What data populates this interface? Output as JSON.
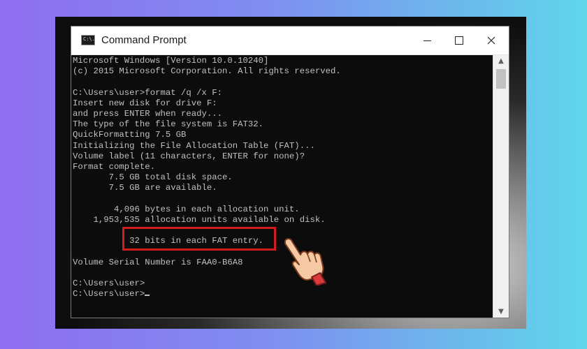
{
  "window": {
    "title": "Command Prompt",
    "icon": "cmd-icon",
    "icon_text": "C:\\."
  },
  "console": {
    "lines": [
      "Microsoft Windows [Version 10.0.10240]",
      "(c) 2015 Microsoft Corporation. All rights reserved.",
      "",
      "C:\\Users\\user>format /q /x F:",
      "Insert new disk for drive F:",
      "and press ENTER when ready...",
      "The type of the file system is FAT32.",
      "QuickFormatting 7.5 GB",
      "Initializing the File Allocation Table (FAT)...",
      "Volume label (11 characters, ENTER for none)?",
      "Format complete.",
      "       7.5 GB total disk space.",
      "       7.5 GB are available.",
      "",
      "        4,096 bytes in each allocation unit.",
      "    1,953,535 allocation units available on disk.",
      "",
      "           32 bits in each FAT entry.",
      "",
      "Volume Serial Number is FAA0-B6A8",
      "",
      "C:\\Users\\user>",
      "C:\\Users\\user>"
    ]
  },
  "colors": {
    "console_bg": "#0c0c0c",
    "console_text": "#c0c0c0",
    "highlight": "#d11d1d",
    "hand_cuff": "#d93a3a"
  },
  "icons": {
    "minimize": "minimize-icon",
    "maximize": "maximize-icon",
    "close": "close-icon",
    "pointer": "pointing-hand-icon"
  }
}
